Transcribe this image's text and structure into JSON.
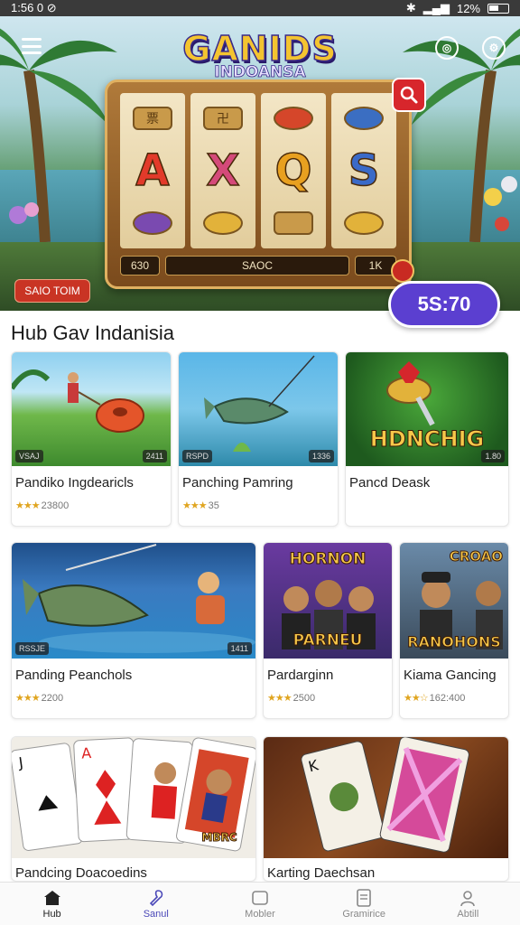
{
  "status_bar": {
    "time": "1:56 0 ⊘",
    "battery": "12%"
  },
  "hero": {
    "logo_main": "GANIDS",
    "logo_sub": "INDOANSA",
    "reels": {
      "top": [
        "票",
        "卍",
        "",
        ""
      ],
      "letters": [
        "A",
        "X",
        "Q",
        "S"
      ]
    },
    "machine_bar": {
      "left": "630",
      "middle": "SAOC",
      "right": "1K"
    },
    "tag": "SAIO TOIM",
    "timer": "5S:70"
  },
  "section_title": "Hub Gav Indanisia",
  "row1": [
    {
      "name": "Pandiko Ingdearicls",
      "meta": "23800",
      "badge_l": "VSAJ",
      "badge_r": "2411"
    },
    {
      "name": "Panching Pamring",
      "meta": "35",
      "badge_l": "RSPD",
      "badge_r": "1336"
    },
    {
      "name": "Pancd Deask",
      "meta": "",
      "thumb_text": "HDNCHIG",
      "badge_r": "1.80"
    }
  ],
  "row2": [
    {
      "name": "Panding Peanchols",
      "meta": "2200",
      "badge_l": "RSSJE",
      "badge_r": "1411"
    },
    {
      "name": "Pardarginn",
      "meta": "2500",
      "thumb_top": "HORNON",
      "thumb_bottom": "PARNEU"
    },
    {
      "name": "Kiama Gancing",
      "meta": "162:400",
      "thumb_top": "CROAO",
      "thumb_bottom": "RANOHONS"
    }
  ],
  "row3": [
    {
      "name": "Pandcing Doacoedins",
      "card_text": "MBRC"
    },
    {
      "name": "Karting Daechsan"
    }
  ],
  "nav": [
    {
      "label": "Hub",
      "icon": "home-icon"
    },
    {
      "label": "Sanul",
      "icon": "pin-icon"
    },
    {
      "label": "Mobler",
      "icon": "square-icon"
    },
    {
      "label": "Gramirice",
      "icon": "document-icon"
    },
    {
      "label": "Abtill",
      "icon": "user-icon"
    }
  ],
  "colors": {
    "accent": "#5b3fd0",
    "tag": "#c93424",
    "star": "#e0a520"
  }
}
